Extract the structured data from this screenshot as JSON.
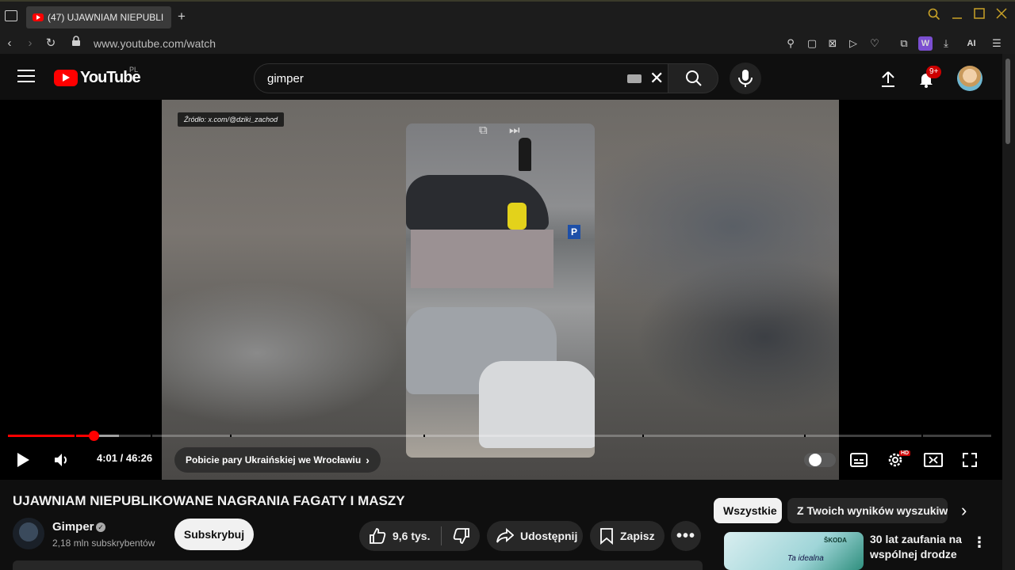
{
  "browser": {
    "tab_title": "(47) UJAWNIAM NIEPUBLI",
    "new_tab": "+",
    "url": "www.youtube.com/watch",
    "ai_label": "AI"
  },
  "header": {
    "logo_text": "YouTube",
    "region": "PL",
    "search_value": "gimper",
    "notifications_badge": "9+"
  },
  "player": {
    "source_tag": "Źródło: x.com/@dziki_zachod",
    "current_time": "4:01 / 46:26",
    "chapter_title": "Pobicie pary Ukraińskiej we Wrocławiu",
    "progress_fraction": 0.087,
    "settings_badge": "HD"
  },
  "video": {
    "title": "UJAWNIAM NIEPUBLIKOWANE NAGRANIA FAGATY I MASZY",
    "channel_name": "Gimper",
    "subscribers": "2,18 mln subskrybentów",
    "subscribe_label": "Subskrybuj",
    "likes": "9,6 tys.",
    "share_label": "Udostępnij",
    "save_label": "Zapisz"
  },
  "sidebar": {
    "chips": [
      "Wszystkie",
      "Z Twoich wyników wyszukiwania"
    ],
    "recommendation": {
      "title": "30 lat zaufania na wspólnej drodze",
      "thumb_brand": "ŠKODA",
      "thumb_text": "Ta idealna"
    }
  },
  "colors": {
    "accent": "#ff0000",
    "background": "#0f0f0f",
    "badge": "#cc0000"
  }
}
